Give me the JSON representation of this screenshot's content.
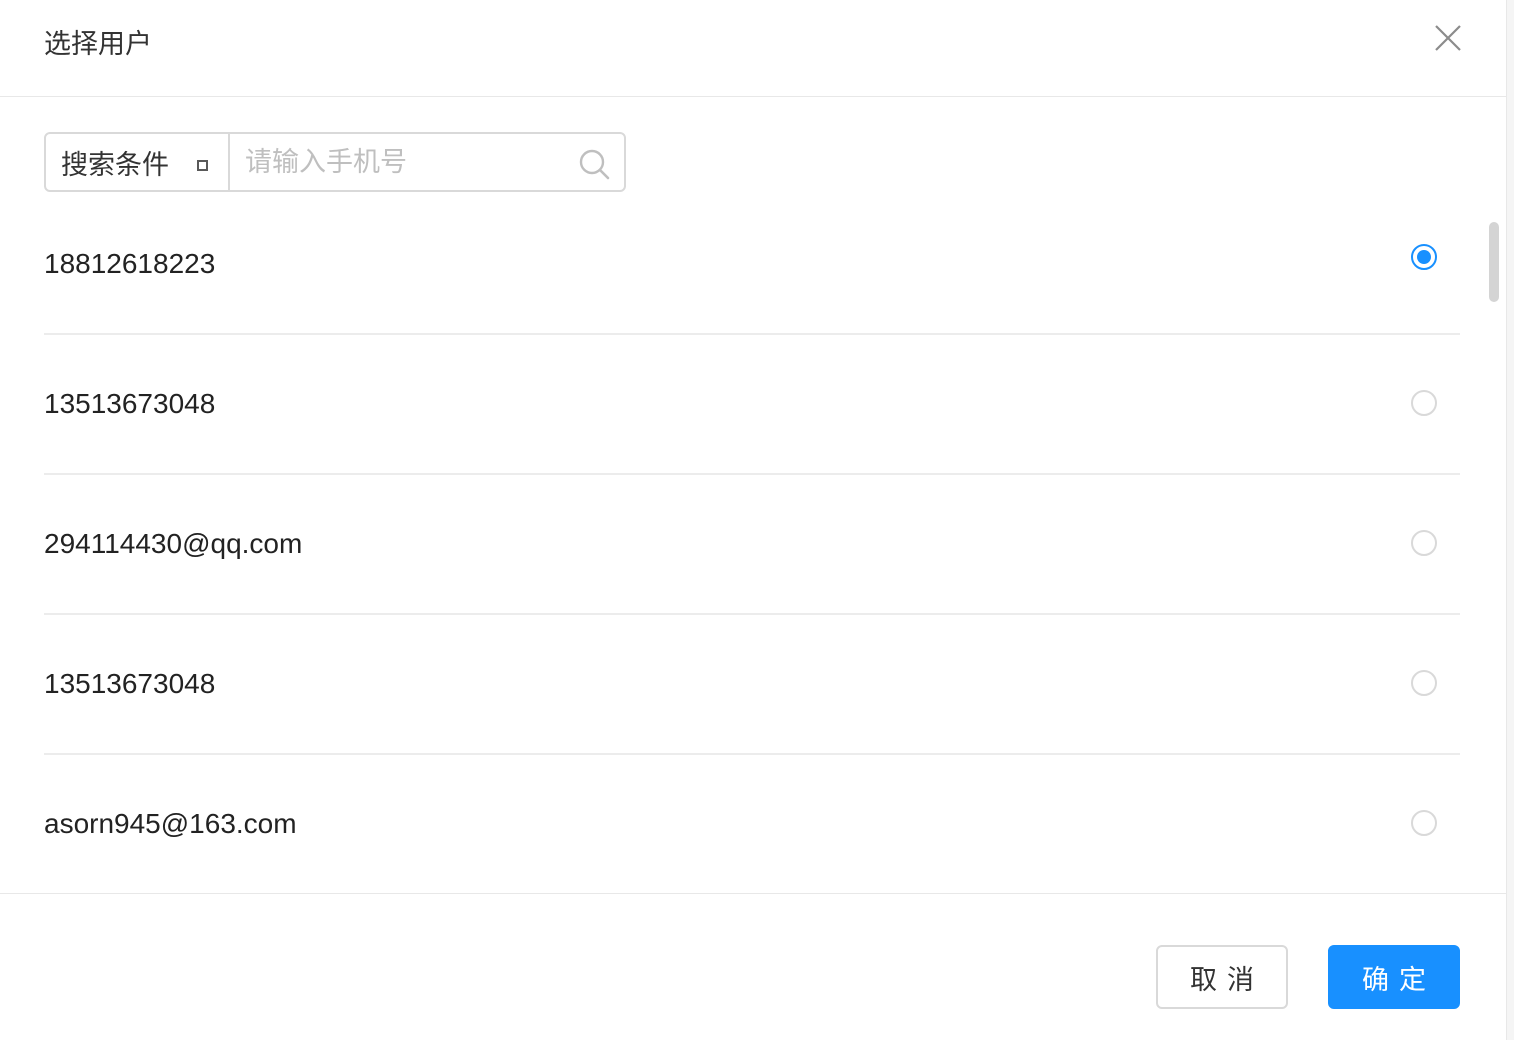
{
  "dialog": {
    "title": "选择用户",
    "close_icon": "close-icon"
  },
  "search": {
    "condition_label": "搜索条件",
    "placeholder": "请输入手机号",
    "search_icon": "search-icon"
  },
  "users": [
    {
      "label": "18812618223",
      "selected": true
    },
    {
      "label": "13513673048",
      "selected": false
    },
    {
      "label": "294114430@qq.com",
      "selected": false
    },
    {
      "label": "13513673048",
      "selected": false
    },
    {
      "label": "asorn945@163.com",
      "selected": false
    }
  ],
  "footer": {
    "cancel_label": "取消",
    "ok_label": "确定"
  },
  "colors": {
    "accent": "#1890ff",
    "border": "#d9d9d9",
    "text": "#333333"
  }
}
